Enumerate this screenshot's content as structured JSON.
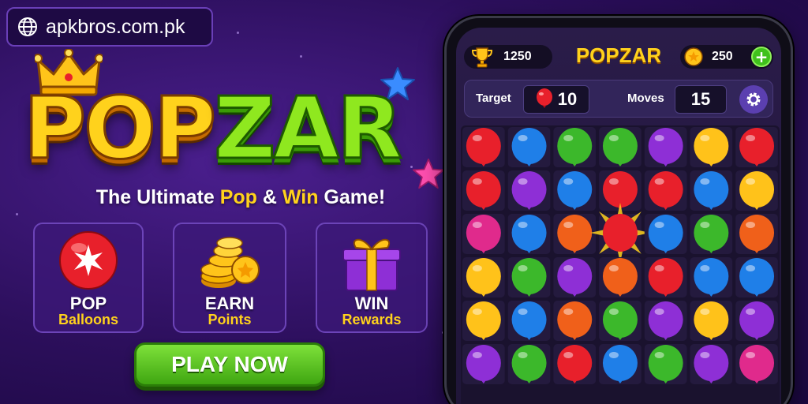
{
  "site": {
    "url": "apkbros.com.pk",
    "icon": "globe-icon"
  },
  "logo": {
    "part1": "POP",
    "part2": "ZAR"
  },
  "tagline": {
    "pre": "The Ultimate ",
    "hl1": "Pop",
    "mid": " & ",
    "hl2": "Win",
    "post": " Game!"
  },
  "features": [
    {
      "title": "POP",
      "sub": "Balloons",
      "icon": "balloon-burst-icon"
    },
    {
      "title": "EARN",
      "sub": "Points",
      "icon": "coins-icon"
    },
    {
      "title": "WIN",
      "sub": "Rewards",
      "icon": "gift-icon"
    }
  ],
  "play_button": "PLAY NOW",
  "game": {
    "title": "POPZAR",
    "trophies": "1250",
    "coins": "250",
    "plus": "+",
    "target_label": "Target",
    "target_value": "10",
    "moves_label": "Moves",
    "moves_value": "15"
  },
  "board": {
    "colors": {
      "r": "#e8202b",
      "b": "#1f7fe8",
      "g": "#3cb82b",
      "p": "#8e2fd6",
      "y": "#ffc21a",
      "o": "#f0601a",
      "k": "#e02a8c"
    },
    "grid": [
      [
        "r",
        "b",
        "g",
        "g",
        "p",
        "y",
        "r"
      ],
      [
        "r",
        "p",
        "b",
        "r",
        "r",
        "b",
        "y"
      ],
      [
        "k",
        "b",
        "o",
        "x",
        "b",
        "g",
        "o"
      ],
      [
        "y",
        "g",
        "p",
        "o",
        "r",
        "b",
        "b"
      ],
      [
        "y",
        "b",
        "o",
        "g",
        "p",
        "y",
        "p"
      ],
      [
        "p",
        "g",
        "r",
        "b",
        "g",
        "p",
        "k"
      ]
    ]
  }
}
